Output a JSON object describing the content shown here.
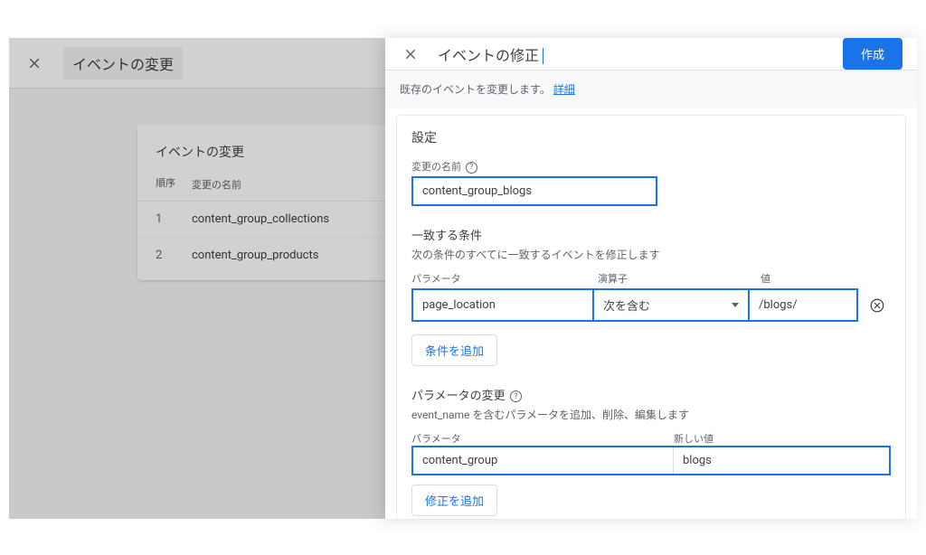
{
  "background": {
    "title": "イベントの変更",
    "card_title": "イベントの変更",
    "col_order": "順序",
    "col_name": "変更の名前",
    "rows": [
      {
        "order": "1",
        "name": "content_group_collections"
      },
      {
        "order": "2",
        "name": "content_group_products"
      }
    ]
  },
  "panel": {
    "title": "イベントの修正",
    "create": "作成",
    "subhead_prefix": "既存のイベントを変更します。",
    "subhead_link": "詳細",
    "settings_title": "設定",
    "name_label": "変更の名前",
    "name_value": "content_group_blogs",
    "conditions_title": "一致する条件",
    "conditions_desc": "次の条件のすべてに一致するイベントを修正します",
    "cond_labels": {
      "param": "パラメータ",
      "op": "演算子",
      "val": "値"
    },
    "cond_row": {
      "param": "page_location",
      "op": "次を含む",
      "val": "/blogs/"
    },
    "add_condition": "条件を追加",
    "params_title": "パラメータの変更",
    "params_desc": "event_name を含むパラメータを追加、削除、編集します",
    "params_labels": {
      "param": "パラメータ",
      "newval": "新しい値"
    },
    "params_row": {
      "param": "content_group",
      "val": "blogs"
    },
    "add_fix": "修正を追加"
  }
}
